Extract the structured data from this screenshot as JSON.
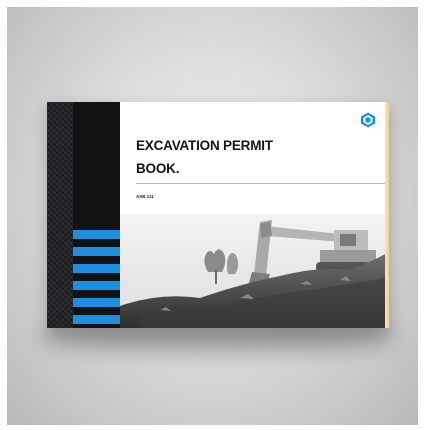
{
  "cover": {
    "title_line1": "EXCAVATION PERMIT",
    "title_line2": "BOOK.",
    "code": "ASB 111"
  },
  "icons": {
    "logo": "shield-logo-icon"
  },
  "colors": {
    "stripe": "#1c8fe0",
    "spine": "#111214",
    "background": "#d6d6d6"
  }
}
